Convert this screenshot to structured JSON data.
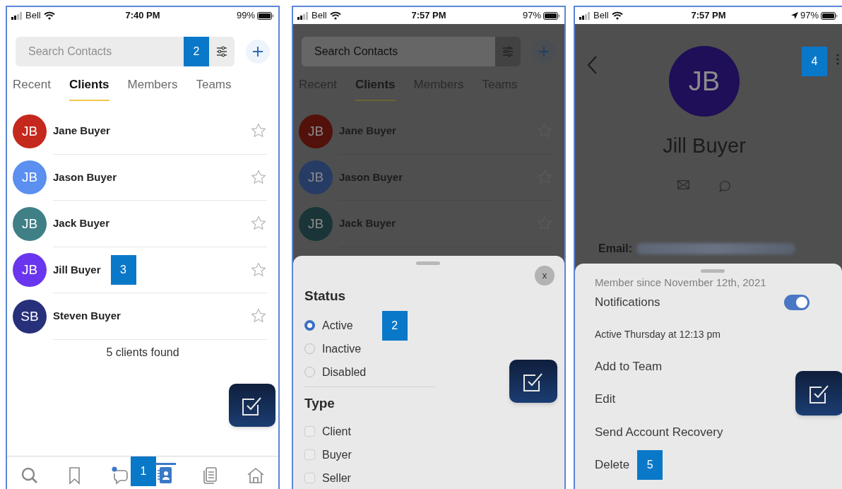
{
  "panels": [
    {
      "kind": "contacts",
      "status_bar": {
        "carrier": "Bell",
        "time": "7:40 PM",
        "battery": "99%"
      },
      "search": {
        "placeholder": "Search Contacts",
        "callout": "2"
      },
      "tabs": [
        {
          "label": "Recent",
          "selected": false
        },
        {
          "label": "Clients",
          "selected": true
        },
        {
          "label": "Members",
          "selected": false
        },
        {
          "label": "Teams",
          "selected": false
        }
      ],
      "contacts": [
        {
          "initials": "JB",
          "name": "Jane Buyer",
          "color": "#c5281c"
        },
        {
          "initials": "JB",
          "name": "Jason Buyer",
          "color": "#5b8ff0"
        },
        {
          "initials": "JB",
          "name": "Jack Buyer",
          "color": "#3f7f86"
        },
        {
          "initials": "JB",
          "name": "Jill Buyer",
          "color": "#6a35ef",
          "callout": "3"
        },
        {
          "initials": "SB",
          "name": "Steven Buyer",
          "color": "#27307a"
        }
      ],
      "result_count": "5 clients found",
      "nav": [
        {
          "kind": "search",
          "selected": false
        },
        {
          "kind": "bookmark",
          "selected": false
        },
        {
          "kind": "chat",
          "selected": false,
          "callout": "1"
        },
        {
          "kind": "contacts",
          "selected": true
        },
        {
          "kind": "documents",
          "selected": false
        },
        {
          "kind": "home",
          "selected": false
        }
      ]
    },
    {
      "kind": "filter",
      "status_bar": {
        "carrier": "Bell",
        "time": "7:57 PM",
        "battery": "97%"
      },
      "search": {
        "placeholder": "Search Contacts"
      },
      "tabs": [
        {
          "label": "Recent",
          "selected": false
        },
        {
          "label": "Clients",
          "selected": true
        },
        {
          "label": "Members",
          "selected": false
        },
        {
          "label": "Teams",
          "selected": false
        }
      ],
      "contacts": [
        {
          "initials": "JB",
          "name": "Jane Buyer",
          "color": "#53110c"
        },
        {
          "initials": "JB",
          "name": "Jason Buyer",
          "color": "#263c65"
        },
        {
          "initials": "JB",
          "name": "Jack Buyer",
          "color": "#1a3538"
        }
      ],
      "sheet": {
        "close": "x",
        "sections": [
          {
            "title": "Status",
            "kind": "radio",
            "options": [
              {
                "label": "Active",
                "selected": true,
                "callout": "2"
              },
              {
                "label": "Inactive",
                "selected": false
              },
              {
                "label": "Disabled",
                "selected": false
              }
            ]
          },
          {
            "title": "Type",
            "kind": "checkbox",
            "options": [
              {
                "label": "Client",
                "checked": false
              },
              {
                "label": "Buyer",
                "checked": false
              },
              {
                "label": "Seller",
                "checked": false
              }
            ]
          }
        ]
      }
    },
    {
      "kind": "profile",
      "status_bar": {
        "carrier": "Bell",
        "time": "7:57 PM",
        "battery": "97%",
        "location": true
      },
      "menu_callout": "4",
      "profile": {
        "initials": "JB",
        "name": "Jill Buyer",
        "email_label": "Email:"
      },
      "sheet": {
        "member_since": "Member since November 12th, 2021",
        "notifications": {
          "label": "Notifications",
          "on": true
        },
        "last_active": "Active Thursday at 12:13 pm",
        "actions": [
          {
            "label": "Add to Team"
          },
          {
            "label": "Edit"
          },
          {
            "label": "Send Account Recovery"
          },
          {
            "label": "Delete",
            "callout": "5"
          }
        ]
      }
    }
  ]
}
